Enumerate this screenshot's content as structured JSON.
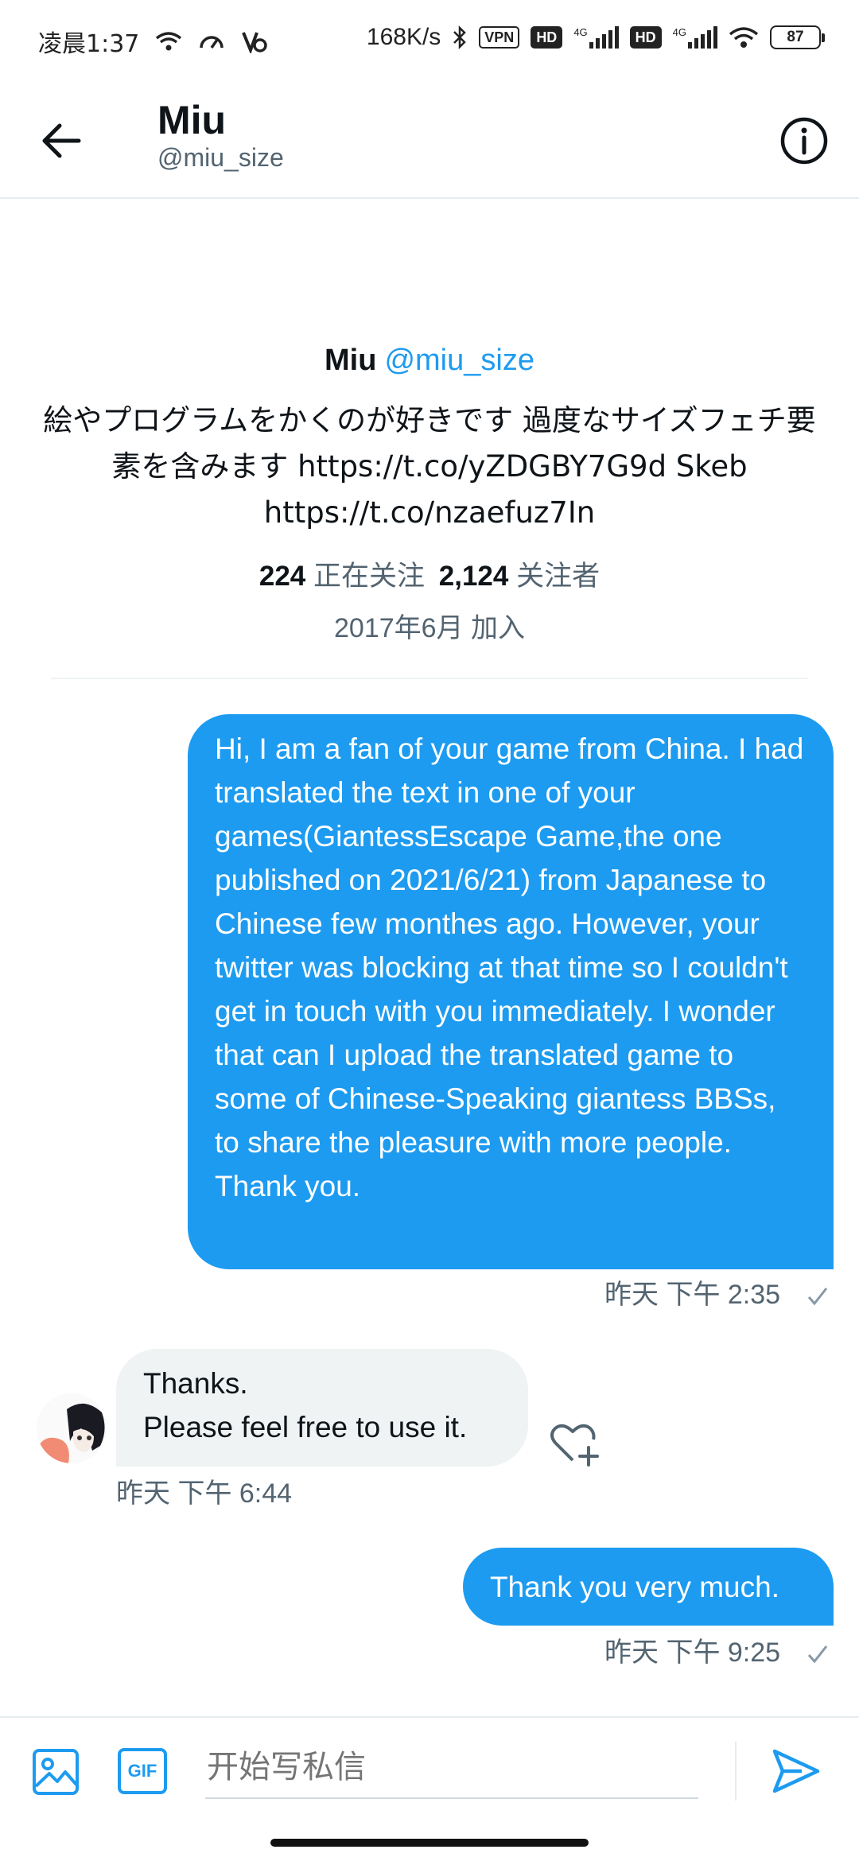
{
  "status_bar": {
    "time": "凌晨1:37",
    "speed": "168K/s",
    "vpn": "VPN",
    "hd1": "HD",
    "net1": "4G",
    "hd2": "HD",
    "net2": "4G",
    "battery": "87"
  },
  "header": {
    "name": "Miu",
    "handle": "@miu_size"
  },
  "profile": {
    "name": "Miu",
    "handle": "@miu_size",
    "bio": "絵やプログラムをかくのが好きです 過度なサイズフェチ要素を含みます https://t.co/yZDGBY7G9d Skeb https://t.co/nzaefuz7In",
    "following_count": "224",
    "following_label": "正在关注",
    "followers_count": "2,124",
    "followers_label": "关注者",
    "joined": "2017年6月 加入"
  },
  "messages": [
    {
      "direction": "outgoing",
      "text": "Hi, I am a fan of your game from China. I had translated the text in one of your games(GiantessEscape Game,the one published on 2021/6/21) from Japanese to Chinese few monthes ago. However, your twitter was blocking at that time so I couldn't get in touch with you immediately. I wonder that can I upload the translated game to some of Chinese-Speaking giantess BBSs, to share the pleasure with more people. Thank you.",
      "time": "昨天 下午 2:35"
    },
    {
      "direction": "incoming",
      "line1": "Thanks.",
      "line2": "Please feel free to use it.",
      "time": "昨天 下午 6:44"
    },
    {
      "direction": "outgoing",
      "text": "Thank you very much.",
      "time": "昨天 下午 9:25"
    }
  ],
  "composer": {
    "gif_label": "GIF",
    "placeholder": "开始写私信"
  },
  "colors": {
    "accent": "#1d9bf0",
    "incoming_bubble": "#eff3f4",
    "secondary_text": "#536471"
  }
}
